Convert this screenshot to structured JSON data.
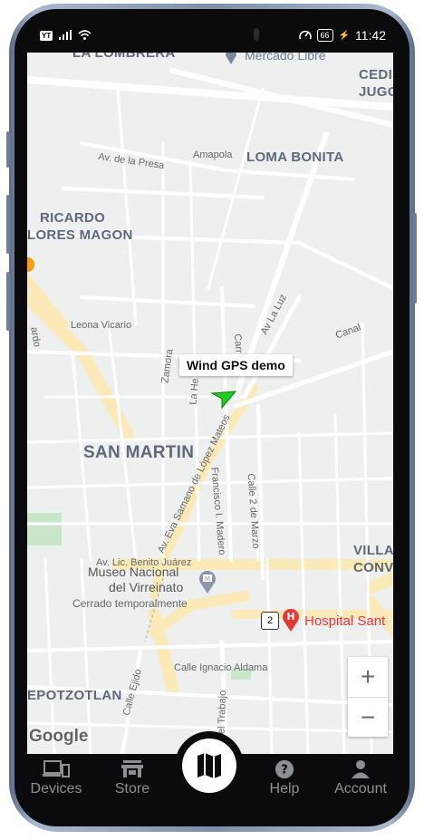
{
  "status_bar": {
    "time": "11:42",
    "battery": "66",
    "yt_badge": "YouTube"
  },
  "map": {
    "areas": {
      "la_lombrera": "LA LOMBRERA",
      "loma_bonita": "LOMA BONITA",
      "ricardo": "RICARDO",
      "flores_magon": "LORES MAGON",
      "san_martin": "SAN MARTIN",
      "cedis": "CEDIS",
      "jugo": "JUGO",
      "villa": "VILLA",
      "conv": "CONV",
      "tepotzotlan": "EPOTZOTLAN"
    },
    "streets": {
      "presa": "Av. de la Presa",
      "amapola": "Amapola",
      "leona_vicario": "Leona Vicario",
      "zamora": "Zamora",
      "la_he": "La He",
      "carr": "Carr",
      "av_la_luz": "Av La Luz",
      "canal": "Canal",
      "eva_samano": "Av. Eva Samano de López Mateos",
      "madero": "Francisco I. Madero",
      "calle2marzo": "Calle 2 de Marzo",
      "benito_juarez": "Av. Lic. Benito Juárez",
      "aldama": "Calle Ignacio Aldama",
      "ejido": "Calle Ejido",
      "trabajo": "del Trabajo",
      "ardo": "ardo"
    },
    "pois": {
      "mercado_libre": "Mercado Libre",
      "museo_line1": "Museo Nacional",
      "museo_line2": "del Virreinato",
      "museo_status": "Cerrado temporalmente",
      "hospital": "Hospital Sant",
      "route_shield": "2"
    },
    "marker_label": "Wind GPS demo",
    "zoom_in": "+",
    "zoom_out": "−",
    "attribution": "Google"
  },
  "nav": {
    "devices": "Devices",
    "store": "Store",
    "help": "Help",
    "account": "Account"
  },
  "colors": {
    "marker": "#22cc22",
    "hospital": "#e53935",
    "nav_text": "#8c8f95"
  }
}
